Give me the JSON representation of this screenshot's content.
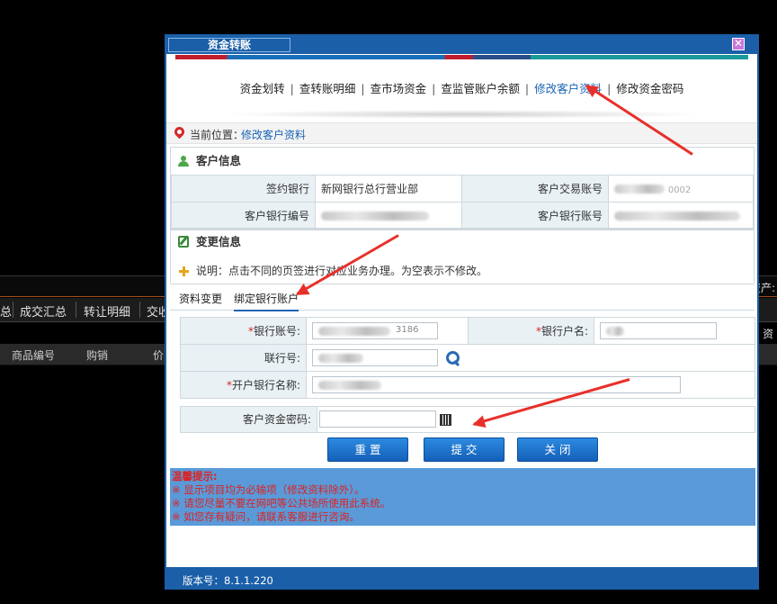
{
  "background": {
    "right_label_top": "资产:",
    "right_label_mid": "资",
    "tabs": [
      "总",
      "成交汇总",
      "转让明细",
      "交收"
    ],
    "columns": [
      "商品编号",
      "购销",
      "价"
    ]
  },
  "dialog": {
    "title": "资金转账",
    "close_icon": "close-icon",
    "nav": [
      "资金划转",
      "查转账明细",
      "查市场资金",
      "查监管账户余额",
      "修改客户资料",
      "修改资金密码"
    ],
    "nav_active": "修改客户资料",
    "location_label": "当前位置：",
    "location_value": "修改客户资料",
    "customer_section": "客户信息",
    "customer": {
      "bank_label": "签约银行",
      "bank_value": "新网银行总行营业部",
      "trade_acct_label": "客户交易账号",
      "trade_acct_value": "0002",
      "bank_no_label": "客户银行编号",
      "bank_acct_label": "客户银行账号"
    },
    "change_section": "变更信息",
    "notice": "说明：点击不同的页签进行对应业务办理。为空表示不修改。",
    "tabs": [
      "资料变更",
      "绑定银行账户"
    ],
    "tab_active": "绑定银行账户",
    "form": {
      "bank_acct_label": "银行账号:",
      "bank_acct_value": "3186",
      "bank_name_label": "银行户名:",
      "branch_no_label": "联行号:",
      "open_bank_label": "开户银行名称:",
      "open_bank_value": "",
      "fund_pwd_label": "客户资金密码:",
      "fund_pwd_value": ""
    },
    "buttons": {
      "reset": "重 置",
      "submit": "提 交",
      "close": "关 闭"
    },
    "tips_title": "温馨提示:",
    "tips": [
      "※ 显示项目均为必输项（修改资料除外）。",
      "※ 请您尽量不要在网吧等公共场所使用此系统。",
      "※ 如您存有疑问，请联系客服进行咨询。"
    ],
    "version": "版本号：8.1.1.220"
  },
  "colors": {
    "accent": "#1a5fa8",
    "link": "#1a64b4",
    "required": "#dd2222",
    "arrow": "#e8302a"
  }
}
